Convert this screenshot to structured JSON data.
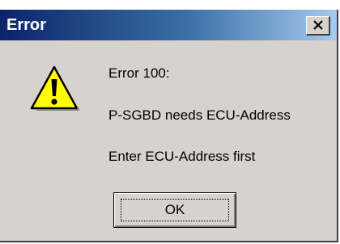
{
  "window": {
    "title": "Error",
    "close_icon": "close-x-icon"
  },
  "content": {
    "icon": "warning-icon",
    "line1": "Error 100:",
    "line2": "P-SGBD needs ECU-Address",
    "line3": "Enter ECU-Address first"
  },
  "buttons": {
    "ok_label": "OK"
  },
  "colors": {
    "titlebar_start": "#0a246a",
    "titlebar_end": "#a6caf0",
    "dialog_bg": "#d6d3ce",
    "warning_fill": "#ffff00"
  }
}
